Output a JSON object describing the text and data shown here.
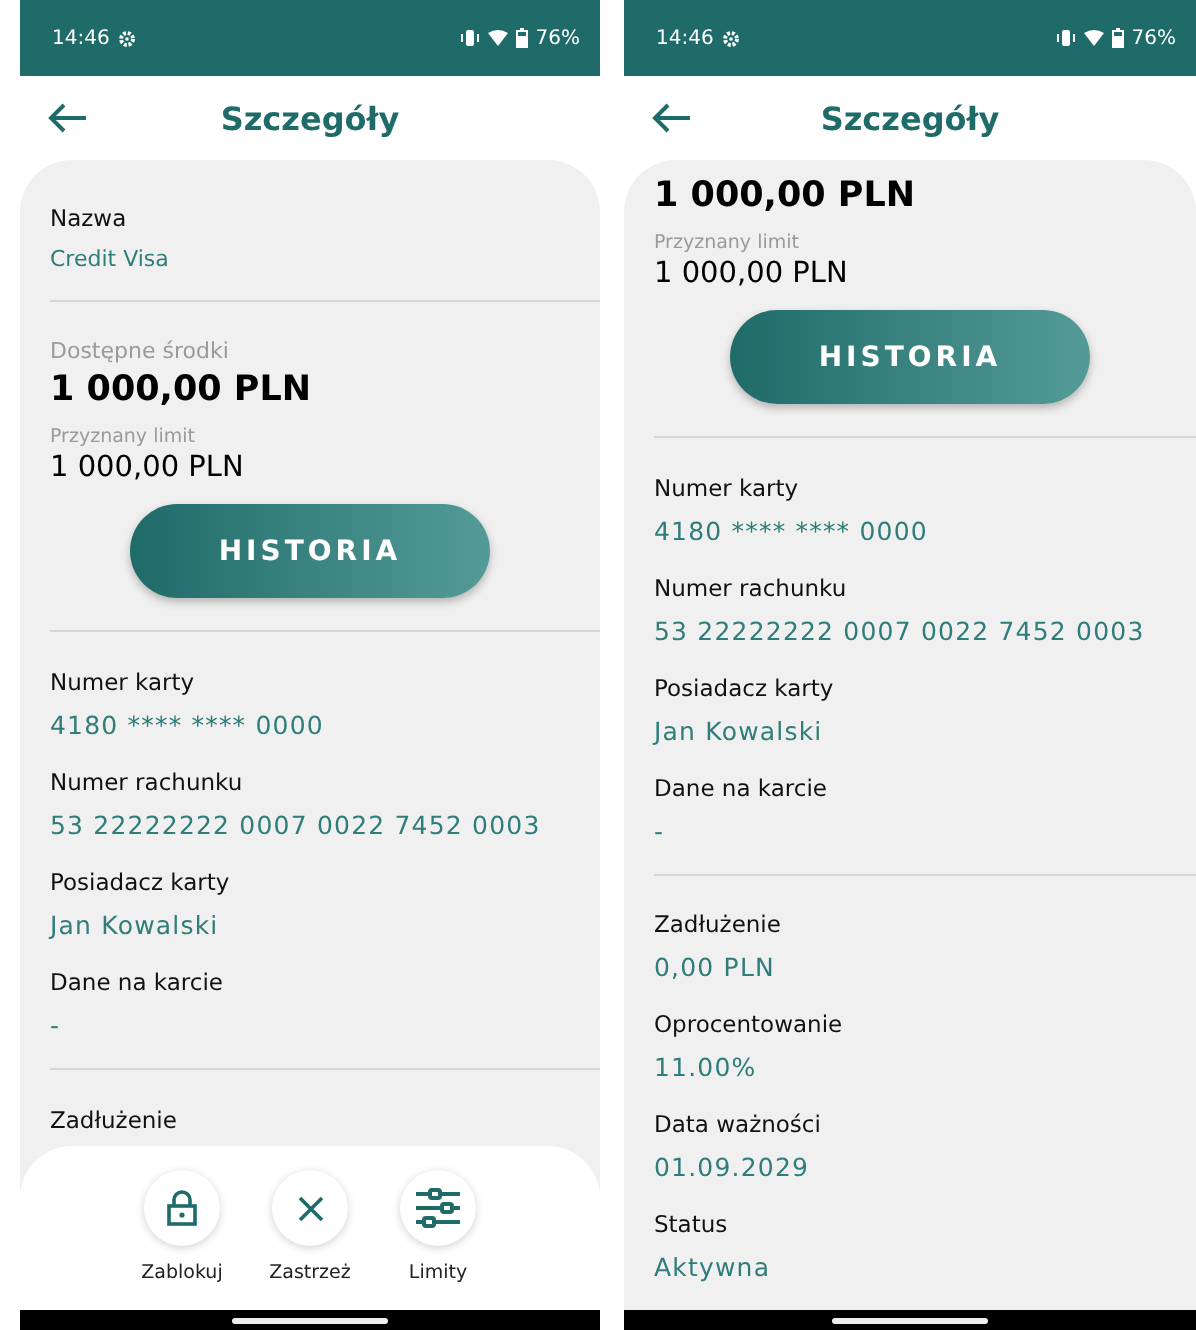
{
  "screens": [
    {
      "status_bar": {
        "time": "14:46",
        "battery": "76%"
      },
      "title": "Szczegóły",
      "items": [
        {
          "kind": "field",
          "label": "Nazwa",
          "value": "Credit Visa"
        },
        {
          "kind": "divider"
        },
        {
          "kind": "balance",
          "label": "Dostępne środki",
          "value": "1 000,00 PLN"
        },
        {
          "kind": "limit",
          "label": "Przyznany limit",
          "value": "1 000,00 PLN"
        },
        {
          "kind": "button",
          "label": "HISTORIA"
        },
        {
          "kind": "divider"
        },
        {
          "kind": "field",
          "label": "Numer karty",
          "value": "4180 **** **** 0000"
        },
        {
          "kind": "field",
          "label": "Numer rachunku",
          "value": "53 22222222 0007 0022 7452 0003"
        },
        {
          "kind": "field",
          "label": "Posiadacz karty",
          "value": "Jan Kowalski"
        },
        {
          "kind": "field",
          "label": "Dane na karcie",
          "value": "-"
        },
        {
          "kind": "divider"
        },
        {
          "kind": "field",
          "label": "Zadłużenie"
        }
      ],
      "actions": [
        {
          "kind": "lock",
          "label": "Zablokuj"
        },
        {
          "kind": "close",
          "label": "Zastrzeż"
        },
        {
          "kind": "sliders",
          "label": "Limity"
        }
      ]
    },
    {
      "status_bar": {
        "time": "14:46",
        "battery": "76%"
      },
      "title": "Szczegóły",
      "items": [
        {
          "kind": "balance",
          "value": "1 000,00 PLN"
        },
        {
          "kind": "limit",
          "label": "Przyznany limit",
          "value": "1 000,00 PLN"
        },
        {
          "kind": "button",
          "label": "HISTORIA"
        },
        {
          "kind": "divider"
        },
        {
          "kind": "field",
          "label": "Numer karty",
          "value": "4180 **** **** 0000"
        },
        {
          "kind": "field",
          "label": "Numer rachunku",
          "value": "53 22222222 0007 0022 7452 0003"
        },
        {
          "kind": "field",
          "label": "Posiadacz karty",
          "value": "Jan Kowalski"
        },
        {
          "kind": "field",
          "label": "Dane na karcie",
          "value": "-"
        },
        {
          "kind": "divider"
        },
        {
          "kind": "field",
          "label": "Zadłużenie",
          "value": "0,00 PLN"
        },
        {
          "kind": "field",
          "label": "Oprocentowanie",
          "value": "11.00%"
        },
        {
          "kind": "field",
          "label": "Data ważności",
          "value": "01.09.2029"
        },
        {
          "kind": "field",
          "label": "Status",
          "value": "Aktywna"
        }
      ]
    }
  ]
}
